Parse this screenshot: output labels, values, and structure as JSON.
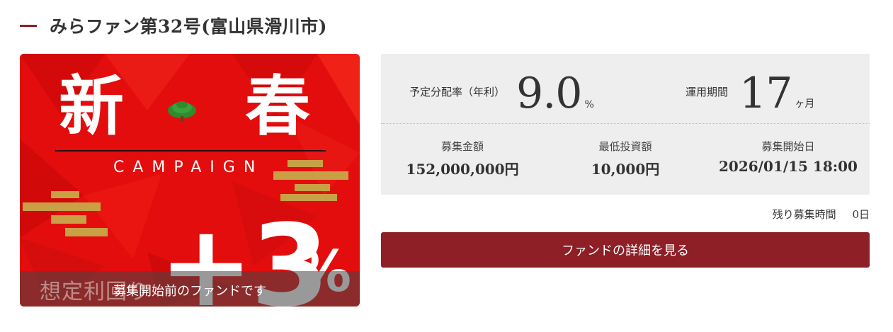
{
  "fund": {
    "title": "みらファン第32号(富山県滑川市)"
  },
  "banner": {
    "kanji_left": "新",
    "kanji_right": "春",
    "campaign_text": "CAMPAIGN",
    "bonus_text": "+3",
    "bonus_unit": "%",
    "faded_label": "想定利回り",
    "status_text": "募集開始前のファンドです",
    "colors": {
      "background": "#e30d0d",
      "gold": "#c9a045",
      "pine": "#2e8b2e"
    }
  },
  "stats": {
    "rate_label": "予定分配率（年利）",
    "rate_value": "9.0",
    "rate_unit": "%",
    "period_label": "運用期間",
    "period_value": "17",
    "period_unit": "ヶ月"
  },
  "details": {
    "amount_label": "募集金額",
    "amount_value": "152,000,000円",
    "min_label": "最低投資額",
    "min_value": "10,000円",
    "start_label": "募集開始日",
    "start_value": "2026/01/15 18:00"
  },
  "remaining": {
    "label": "残り募集時間",
    "value": "0日"
  },
  "action": {
    "detail_button": "ファンドの詳細を見る",
    "accent": "#8e1f27"
  }
}
